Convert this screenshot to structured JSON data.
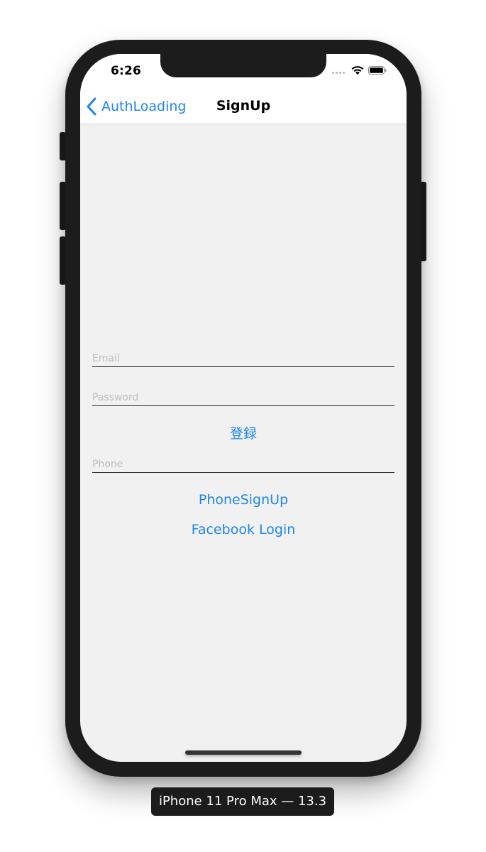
{
  "status_bar": {
    "time": "6:26"
  },
  "nav": {
    "back_label": "AuthLoading",
    "title": "SignUp"
  },
  "form": {
    "email_placeholder": "Email",
    "password_placeholder": "Password",
    "register_label": "登録",
    "phone_placeholder": "Phone",
    "phone_signup_label": "PhoneSignUp",
    "facebook_login_label": "Facebook Login"
  },
  "device_label": "iPhone 11 Pro Max — 13.3",
  "colors": {
    "accent": "#1f86ea",
    "background": "#f1f1f1",
    "device_frame": "#1c1c1c"
  },
  "icons": {
    "back": "chevron-left-icon",
    "signal": "signal-icon",
    "wifi": "wifi-icon",
    "battery": "battery-icon"
  }
}
